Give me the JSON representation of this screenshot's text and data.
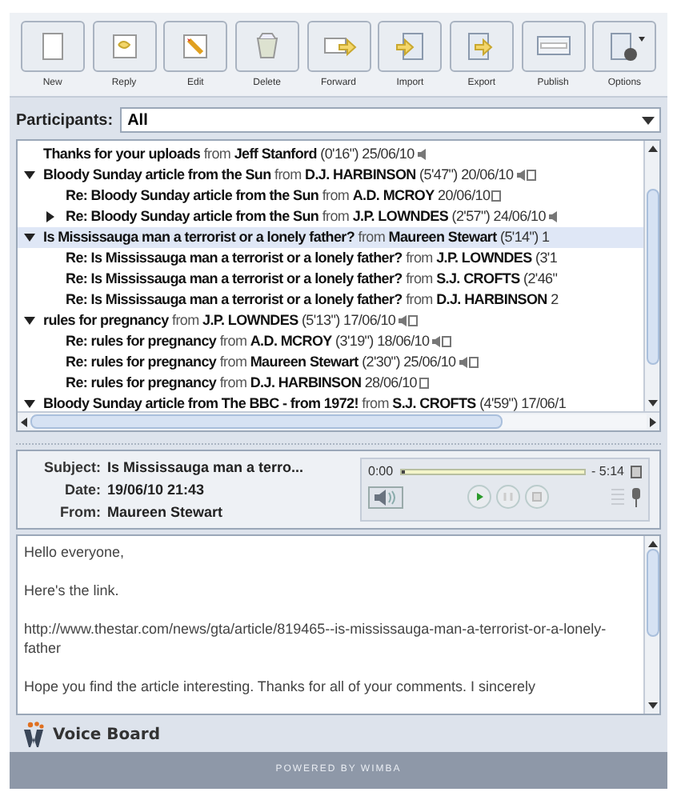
{
  "toolbar": [
    {
      "label": "New",
      "kind": "new"
    },
    {
      "label": "Reply",
      "kind": "reply"
    },
    {
      "label": "Edit",
      "kind": "edit"
    },
    {
      "label": "Delete",
      "kind": "delete"
    },
    {
      "label": "Forward",
      "kind": "forward"
    },
    {
      "label": "Import",
      "kind": "import"
    },
    {
      "label": "Export",
      "kind": "export"
    },
    {
      "label": "Publish",
      "kind": "publish"
    },
    {
      "label": "Options",
      "kind": "options"
    }
  ],
  "participants": {
    "label": "Participants:",
    "value": "All"
  },
  "threads": [
    {
      "subject": "Thanks for your uploads",
      "from": "from",
      "author": "Jeff Stanford",
      "info": "(0'16\") 25/06/10",
      "kind": "audio",
      "selected": false
    },
    {
      "subject": "Bloody Sunday article from the Sun",
      "from": "from",
      "author": "D.J. HARBINSON",
      "info": "(5'47\") 20/06/10",
      "kind": "both",
      "selected": false,
      "expanded": true,
      "children": [
        {
          "subject": "Re: Bloody Sunday article from the Sun",
          "from": "from",
          "author": "A.D. MCROY",
          "info": "20/06/10",
          "kind": "text",
          "selected": false
        },
        {
          "subject": "Re: Bloody Sunday article from the Sun",
          "from": "from",
          "author": "J.P. LOWNDES",
          "info": "(2'57\") 24/06/10",
          "kind": "audio",
          "selected": false,
          "expanded": false
        }
      ]
    },
    {
      "subject": "Is Mississauga man a terrorist or a lonely father?",
      "from": "from",
      "author": "Maureen Stewart",
      "info": "(5'14\") 1",
      "selected": true,
      "expanded": true,
      "children": [
        {
          "subject": "Re: Is Mississauga man a terrorist or a lonely father?",
          "from": "from",
          "author": "J.P. LOWNDES",
          "info": "(3'1",
          "selected": false
        },
        {
          "subject": "Re: Is Mississauga man a terrorist or a lonely father?",
          "from": "from",
          "author": "S.J. CROFTS",
          "info": "(2'46\"",
          "selected": false
        },
        {
          "subject": "Re: Is Mississauga man a terrorist or a lonely father?",
          "from": "from",
          "author": "D.J. HARBINSON",
          "info": "2",
          "selected": false
        }
      ]
    },
    {
      "subject": "rules for pregnancy",
      "from": "from",
      "author": "J.P. LOWNDES",
      "info": "(5'13\") 17/06/10",
      "kind": "both",
      "selected": false,
      "expanded": true,
      "children": [
        {
          "subject": "Re: rules for pregnancy",
          "from": "from",
          "author": "A.D. MCROY",
          "info": "(3'19\") 18/06/10",
          "kind": "both",
          "selected": false
        },
        {
          "subject": "Re: rules for pregnancy",
          "from": "from",
          "author": "Maureen Stewart",
          "info": "(2'30\") 25/06/10",
          "kind": "both",
          "selected": false
        },
        {
          "subject": "Re: rules for pregnancy",
          "from": "from",
          "author": "D.J. HARBINSON",
          "info": "28/06/10",
          "kind": "text",
          "selected": false
        }
      ]
    },
    {
      "subject": "Bloody Sunday article from The BBC - from 1972!",
      "from": "from",
      "author": "S.J. CROFTS",
      "info": "(4'59\") 17/06/1",
      "selected": false,
      "expanded": true
    }
  ],
  "message": {
    "fields": [
      {
        "label": "Subject:",
        "value": "Is Mississauga man a terro..."
      },
      {
        "label": "Date:",
        "value": "19/06/10 21:43"
      },
      {
        "label": "From:",
        "value": "Maureen Stewart"
      }
    ],
    "player": {
      "elapsed": "0:00",
      "remaining": "- 5:14",
      "level": 0.02
    },
    "body": [
      "Hello everyone,",
      "Here's the link.",
      "http://www.thestar.com/news/gta/article/819465--is-mississauga-man-a-terrorist-or-a-lonely-father",
      "Hope you find the article interesting.  Thanks for all of your comments.  I sincerely"
    ]
  },
  "brand": "Voice Board",
  "footer": "POWERED BY WIMBA"
}
